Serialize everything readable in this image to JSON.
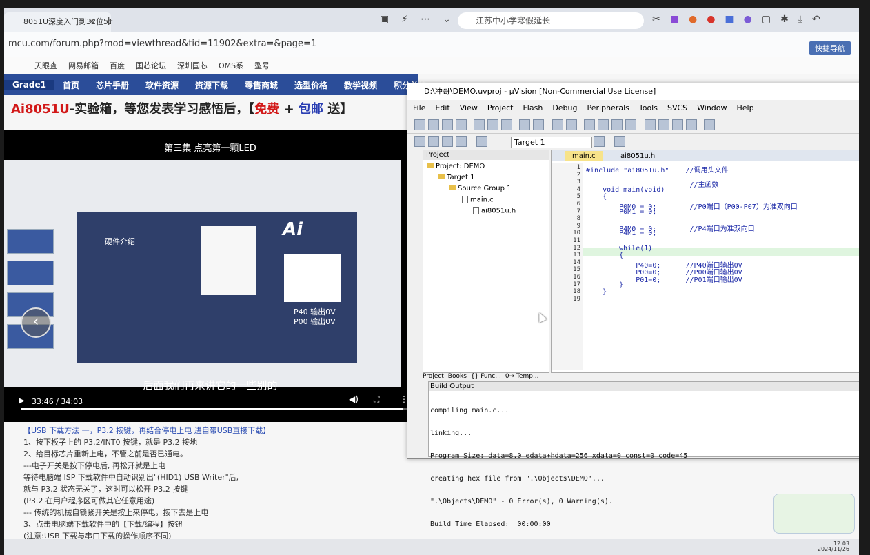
{
  "browser": {
    "tab_title": "8051U深度入门到32位51…",
    "search_text": "江苏中小学寒假延长",
    "url": "mcu.com/forum.php?mod=viewthread&tid=11902&extra=&page=1",
    "quick_nav": "快捷导航",
    "bookmarks": [
      "天眼查",
      "网易邮箱",
      "百度",
      "国芯论坛",
      "深圳国芯",
      "OMS系",
      "型号"
    ]
  },
  "site": {
    "nav": [
      "Grade1",
      "首页",
      "芯片手册",
      "软件资源",
      "资源下载",
      "零售商城",
      "选型价格",
      "教学视频",
      "积分兑换"
    ],
    "promo_prefix": "Ai8051U",
    "promo_mid": "-实验箱，等您发表学习感悟后，【",
    "promo_free": "免费",
    "promo_plus": " + ",
    "promo_ship": "包邮",
    "promo_end": " 送】"
  },
  "video": {
    "title": "第三集 点亮第一颗LED",
    "slide_title": "硬件介绍",
    "slide_brand": "Ai",
    "slide_line1": "P40 输出0V",
    "slide_line2": "P00 输出0V",
    "subtitle": "后面我们再来讲它的一些别的",
    "time": "33:46 / 34:03",
    "progress": 0.99
  },
  "article": {
    "lines": [
      "【USB 下载方法 一，P3.2 按键，再结合停电上电 进自带USB直接下载】",
      "1、按下板子上的 P3.2/INT0 按键，就是 P3.2 接地",
      "2、给目标芯片重新上电，不管之前是否已通电。",
      "---电子开关是按下停电后, 再松开就是上电",
      "    等待电脑端 ISP 下载软件中自动识别出\"(HID1) USB Writer\"后,",
      "    就与 P3.2 状态无关了，这时可以松开 P3.2 按键",
      "    (P3.2 在用户程序区可做其它任意用途)",
      "--- 传统的机械自锁紧开关是按上来停电，按下去是上电",
      "3、点击电脑端下载软件中的【下载/编程】按钮",
      "    (注意:USB 下载与串口下载的操作顺序不同)"
    ]
  },
  "uvision": {
    "title": "D:\\冲哥\\DEMO.uvproj - µVision [Non-Commercial Use License]",
    "menu": [
      "File",
      "Edit",
      "View",
      "Project",
      "Flash",
      "Debug",
      "Peripherals",
      "Tools",
      "SVCS",
      "Window",
      "Help"
    ],
    "target": "Target 1",
    "project_header": "Project",
    "tree": [
      "Project: DEMO",
      "Target 1",
      "Source Group 1",
      "main.c",
      "ai8051u.h"
    ],
    "proj_tabs": [
      "Project",
      "Books",
      "{} Func...",
      "0→ Temp..."
    ],
    "editor_tabs": [
      "main.c",
      "ai8051u.h"
    ],
    "code_lines": [
      "#include \"ai8051u.h\"    //调用头文件",
      "",
      "                         //主函数",
      "    void main(void)",
      "    {",
      "        P0M0 = 0;        //P0端口（P00-P07）为准双向口",
      "        P0M1 = 0;",
      "",
      "        P4M0 = 0;        //P4端口为准双向口",
      "        P4M1 = 0;",
      "",
      "        while(1)",
      "        {",
      "            P40=0;      //P40端口输出0V",
      "            P00=0;      //P00端口输出0V",
      "            P01=0;      //P01端口输出0V",
      "        }",
      "    }",
      ""
    ],
    "build_header": "Build Output",
    "build_lines": [
      "compiling main.c...",
      "linking...",
      "Program Size: data=8.0 edata+hdata=256 xdata=0 const=0 code=45",
      "creating hex file from \".\\Objects\\DEMO\"...",
      "\".\\Objects\\DEMO\" - 0 Error(s), 0 Warning(s).",
      "Build Time Elapsed:  00:00:00"
    ]
  },
  "taskbar": {
    "time": "12:03",
    "date": "2024/11/26"
  }
}
